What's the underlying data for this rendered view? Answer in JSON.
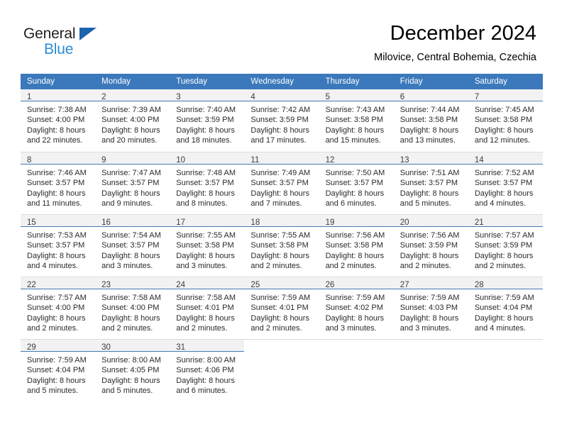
{
  "brand": {
    "name_top": "General",
    "name_bottom": "Blue",
    "triangle_color": "#1B63AD",
    "top_color": "#231F20",
    "bottom_color": "#2E8BD4"
  },
  "header": {
    "title": "December 2024",
    "subtitle": "Milovice, Central Bohemia, Czechia",
    "header_bg": "#3B79BC",
    "daynum_bg": "#F2F2F2",
    "divider_color": "#4579B4"
  },
  "weekdays": [
    "Sunday",
    "Monday",
    "Tuesday",
    "Wednesday",
    "Thursday",
    "Friday",
    "Saturday"
  ],
  "weeks": [
    {
      "days": [
        {
          "num": "1",
          "sunrise": "Sunrise: 7:38 AM",
          "sunset": "Sunset: 4:00 PM",
          "daylight1": "Daylight: 8 hours",
          "daylight2": "and 22 minutes."
        },
        {
          "num": "2",
          "sunrise": "Sunrise: 7:39 AM",
          "sunset": "Sunset: 4:00 PM",
          "daylight1": "Daylight: 8 hours",
          "daylight2": "and 20 minutes."
        },
        {
          "num": "3",
          "sunrise": "Sunrise: 7:40 AM",
          "sunset": "Sunset: 3:59 PM",
          "daylight1": "Daylight: 8 hours",
          "daylight2": "and 18 minutes."
        },
        {
          "num": "4",
          "sunrise": "Sunrise: 7:42 AM",
          "sunset": "Sunset: 3:59 PM",
          "daylight1": "Daylight: 8 hours",
          "daylight2": "and 17 minutes."
        },
        {
          "num": "5",
          "sunrise": "Sunrise: 7:43 AM",
          "sunset": "Sunset: 3:58 PM",
          "daylight1": "Daylight: 8 hours",
          "daylight2": "and 15 minutes."
        },
        {
          "num": "6",
          "sunrise": "Sunrise: 7:44 AM",
          "sunset": "Sunset: 3:58 PM",
          "daylight1": "Daylight: 8 hours",
          "daylight2": "and 13 minutes."
        },
        {
          "num": "7",
          "sunrise": "Sunrise: 7:45 AM",
          "sunset": "Sunset: 3:58 PM",
          "daylight1": "Daylight: 8 hours",
          "daylight2": "and 12 minutes."
        }
      ]
    },
    {
      "days": [
        {
          "num": "8",
          "sunrise": "Sunrise: 7:46 AM",
          "sunset": "Sunset: 3:57 PM",
          "daylight1": "Daylight: 8 hours",
          "daylight2": "and 11 minutes."
        },
        {
          "num": "9",
          "sunrise": "Sunrise: 7:47 AM",
          "sunset": "Sunset: 3:57 PM",
          "daylight1": "Daylight: 8 hours",
          "daylight2": "and 9 minutes."
        },
        {
          "num": "10",
          "sunrise": "Sunrise: 7:48 AM",
          "sunset": "Sunset: 3:57 PM",
          "daylight1": "Daylight: 8 hours",
          "daylight2": "and 8 minutes."
        },
        {
          "num": "11",
          "sunrise": "Sunrise: 7:49 AM",
          "sunset": "Sunset: 3:57 PM",
          "daylight1": "Daylight: 8 hours",
          "daylight2": "and 7 minutes."
        },
        {
          "num": "12",
          "sunrise": "Sunrise: 7:50 AM",
          "sunset": "Sunset: 3:57 PM",
          "daylight1": "Daylight: 8 hours",
          "daylight2": "and 6 minutes."
        },
        {
          "num": "13",
          "sunrise": "Sunrise: 7:51 AM",
          "sunset": "Sunset: 3:57 PM",
          "daylight1": "Daylight: 8 hours",
          "daylight2": "and 5 minutes."
        },
        {
          "num": "14",
          "sunrise": "Sunrise: 7:52 AM",
          "sunset": "Sunset: 3:57 PM",
          "daylight1": "Daylight: 8 hours",
          "daylight2": "and 4 minutes."
        }
      ]
    },
    {
      "days": [
        {
          "num": "15",
          "sunrise": "Sunrise: 7:53 AM",
          "sunset": "Sunset: 3:57 PM",
          "daylight1": "Daylight: 8 hours",
          "daylight2": "and 4 minutes."
        },
        {
          "num": "16",
          "sunrise": "Sunrise: 7:54 AM",
          "sunset": "Sunset: 3:57 PM",
          "daylight1": "Daylight: 8 hours",
          "daylight2": "and 3 minutes."
        },
        {
          "num": "17",
          "sunrise": "Sunrise: 7:55 AM",
          "sunset": "Sunset: 3:58 PM",
          "daylight1": "Daylight: 8 hours",
          "daylight2": "and 3 minutes."
        },
        {
          "num": "18",
          "sunrise": "Sunrise: 7:55 AM",
          "sunset": "Sunset: 3:58 PM",
          "daylight1": "Daylight: 8 hours",
          "daylight2": "and 2 minutes."
        },
        {
          "num": "19",
          "sunrise": "Sunrise: 7:56 AM",
          "sunset": "Sunset: 3:58 PM",
          "daylight1": "Daylight: 8 hours",
          "daylight2": "and 2 minutes."
        },
        {
          "num": "20",
          "sunrise": "Sunrise: 7:56 AM",
          "sunset": "Sunset: 3:59 PM",
          "daylight1": "Daylight: 8 hours",
          "daylight2": "and 2 minutes."
        },
        {
          "num": "21",
          "sunrise": "Sunrise: 7:57 AM",
          "sunset": "Sunset: 3:59 PM",
          "daylight1": "Daylight: 8 hours",
          "daylight2": "and 2 minutes."
        }
      ]
    },
    {
      "days": [
        {
          "num": "22",
          "sunrise": "Sunrise: 7:57 AM",
          "sunset": "Sunset: 4:00 PM",
          "daylight1": "Daylight: 8 hours",
          "daylight2": "and 2 minutes."
        },
        {
          "num": "23",
          "sunrise": "Sunrise: 7:58 AM",
          "sunset": "Sunset: 4:00 PM",
          "daylight1": "Daylight: 8 hours",
          "daylight2": "and 2 minutes."
        },
        {
          "num": "24",
          "sunrise": "Sunrise: 7:58 AM",
          "sunset": "Sunset: 4:01 PM",
          "daylight1": "Daylight: 8 hours",
          "daylight2": "and 2 minutes."
        },
        {
          "num": "25",
          "sunrise": "Sunrise: 7:59 AM",
          "sunset": "Sunset: 4:01 PM",
          "daylight1": "Daylight: 8 hours",
          "daylight2": "and 2 minutes."
        },
        {
          "num": "26",
          "sunrise": "Sunrise: 7:59 AM",
          "sunset": "Sunset: 4:02 PM",
          "daylight1": "Daylight: 8 hours",
          "daylight2": "and 3 minutes."
        },
        {
          "num": "27",
          "sunrise": "Sunrise: 7:59 AM",
          "sunset": "Sunset: 4:03 PM",
          "daylight1": "Daylight: 8 hours",
          "daylight2": "and 3 minutes."
        },
        {
          "num": "28",
          "sunrise": "Sunrise: 7:59 AM",
          "sunset": "Sunset: 4:04 PM",
          "daylight1": "Daylight: 8 hours",
          "daylight2": "and 4 minutes."
        }
      ]
    },
    {
      "days": [
        {
          "num": "29",
          "sunrise": "Sunrise: 7:59 AM",
          "sunset": "Sunset: 4:04 PM",
          "daylight1": "Daylight: 8 hours",
          "daylight2": "and 5 minutes."
        },
        {
          "num": "30",
          "sunrise": "Sunrise: 8:00 AM",
          "sunset": "Sunset: 4:05 PM",
          "daylight1": "Daylight: 8 hours",
          "daylight2": "and 5 minutes."
        },
        {
          "num": "31",
          "sunrise": "Sunrise: 8:00 AM",
          "sunset": "Sunset: 4:06 PM",
          "daylight1": "Daylight: 8 hours",
          "daylight2": "and 6 minutes."
        },
        {
          "num": "",
          "sunrise": "",
          "sunset": "",
          "daylight1": "",
          "daylight2": ""
        },
        {
          "num": "",
          "sunrise": "",
          "sunset": "",
          "daylight1": "",
          "daylight2": ""
        },
        {
          "num": "",
          "sunrise": "",
          "sunset": "",
          "daylight1": "",
          "daylight2": ""
        },
        {
          "num": "",
          "sunrise": "",
          "sunset": "",
          "daylight1": "",
          "daylight2": ""
        }
      ]
    }
  ]
}
